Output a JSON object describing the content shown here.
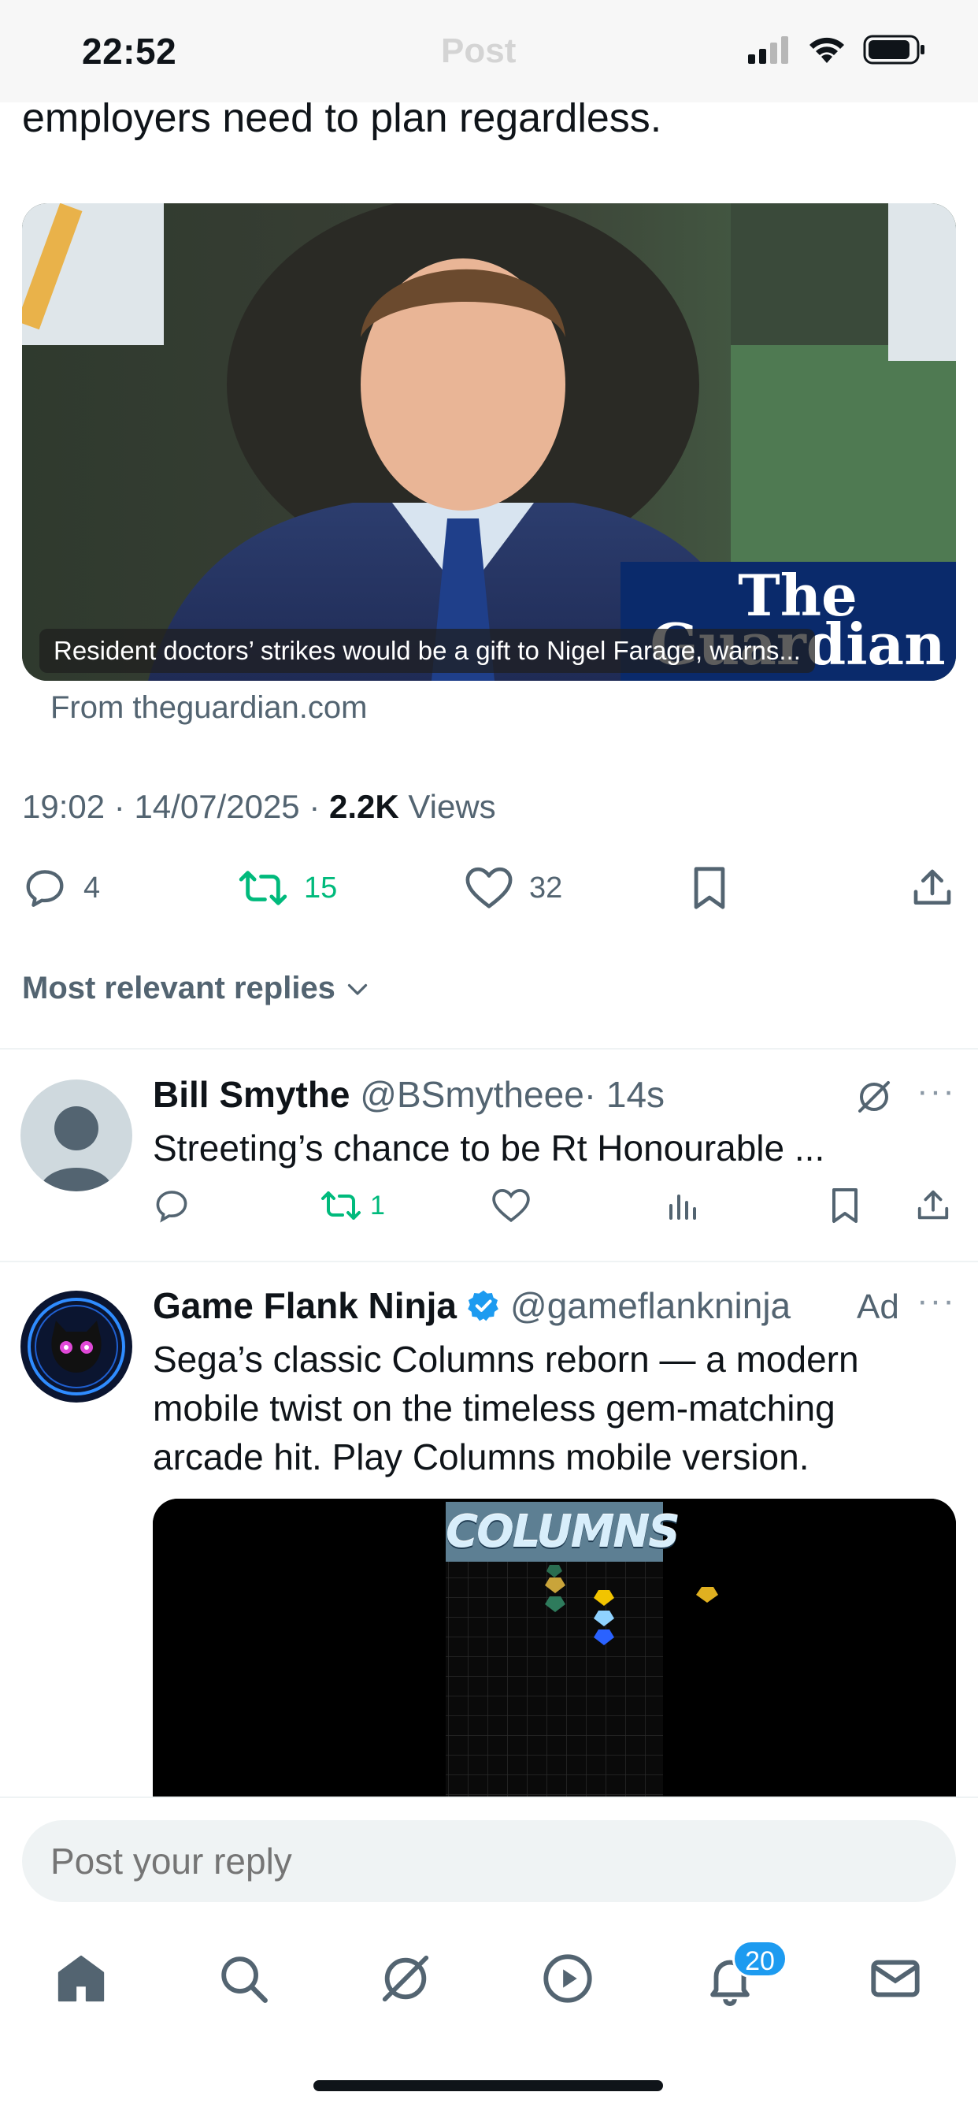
{
  "status_bar": {
    "time": "22:52",
    "ghost_title": "Post"
  },
  "tweet": {
    "text_tail": "employers need to plan regardless.",
    "media": {
      "caption": "Resident doctors’ strikes would be a gift to Nigel Farage, warns...",
      "brand_line1": "The",
      "brand_line2": "Guardian",
      "source": "From theguardian.com"
    },
    "meta": {
      "time": "19:02",
      "date": "14/07/2025",
      "views_count": "2.2K",
      "views_label": "Views",
      "sep": "·"
    },
    "actions": {
      "replies": "4",
      "reposts": "15",
      "likes": "32"
    }
  },
  "replies_sort": {
    "label": "Most relevant replies"
  },
  "reply": {
    "name": "Bill Smythe",
    "handle": "@BSmytheee",
    "age": "· 14s",
    "text": "Streeting’s chance to be Rt Honourable ...",
    "reposts": "1"
  },
  "ad": {
    "name": "Game Flank Ninja",
    "handle": "@gameflankninja",
    "ad_label": "Ad",
    "text_lines": [
      "Sega’s classic Columns reborn — a modern",
      "mobile twist on the timeless gem-matching",
      "arcade hit. Play Columns mobile version."
    ],
    "game_logo": "COLUMNS"
  },
  "reply_bar": {
    "placeholder": "Post your reply"
  },
  "tab_bar": {
    "notifications_badge": "20"
  },
  "colors": {
    "repost_green": "#00ba7c",
    "verified_blue": "#1d9bf0",
    "muted": "#536471"
  }
}
